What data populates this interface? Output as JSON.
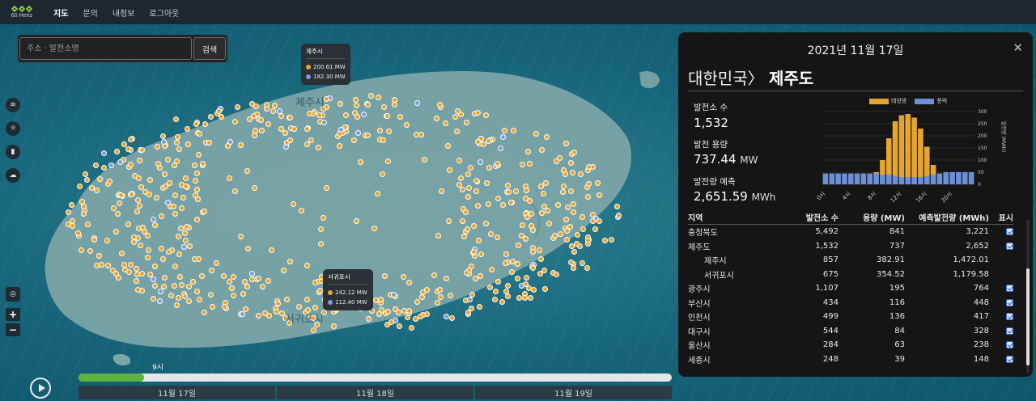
{
  "nav": {
    "logo_text": "60 Hertz",
    "links": [
      "지도",
      "문의",
      "내정보",
      "로그아웃"
    ]
  },
  "search": {
    "placeholder": "주소 · 발전소명",
    "button": "검색"
  },
  "map": {
    "labels": [
      "제주시",
      "서귀포시"
    ],
    "popup_jeju": {
      "title": "제주시",
      "solar": "200.61 MW",
      "wind": "182.30 MW"
    },
    "popup_seogwipo": {
      "title": "서귀포시",
      "solar": "242.12 MW",
      "wind": "112.40 MW"
    },
    "colors": {
      "solar": "#e6a531",
      "wind": "#7e9bd6"
    }
  },
  "timeline": {
    "current": "9시",
    "progress": 0.11,
    "dates": [
      "11월 17일",
      "11월 18일",
      "11월 19일"
    ]
  },
  "panel": {
    "date": "2021년 11월 17일",
    "region_parent": "대한민국〉",
    "region": "제주도",
    "stats": {
      "count_label": "발전소 수",
      "count": "1,532",
      "capacity_label": "발전 용량",
      "capacity": "737.44",
      "capacity_unit": "MW",
      "forecast_label": "발전량 예측",
      "forecast": "2,651.59",
      "forecast_unit": "MWh"
    },
    "table": {
      "headers": [
        "지역",
        "발전소 수",
        "용량 (MW)",
        "예측발전량 (MWh)",
        "표시"
      ],
      "rows": [
        [
          "충청북도",
          "5,492",
          "841",
          "3,221"
        ],
        [
          "제주도",
          "1,532",
          "737",
          "2,652"
        ],
        [
          "제주시",
          "857",
          "382.91",
          "1,472.01"
        ],
        [
          "서귀포시",
          "675",
          "354.52",
          "1,179.58"
        ],
        [
          "광주시",
          "1,107",
          "195",
          "764"
        ],
        [
          "부산시",
          "434",
          "116",
          "448"
        ],
        [
          "인천시",
          "499",
          "136",
          "417"
        ],
        [
          "대구시",
          "544",
          "84",
          "328"
        ],
        [
          "울산시",
          "284",
          "63",
          "238"
        ],
        [
          "세종시",
          "248",
          "39",
          "148"
        ]
      ],
      "sub_rows": [
        2,
        3
      ]
    }
  },
  "chart_data": {
    "type": "bar",
    "stacked": true,
    "legend_position": "top",
    "categories": [
      "0시",
      "1시",
      "2시",
      "3시",
      "4시",
      "5시",
      "6시",
      "7시",
      "8시",
      "9시",
      "10시",
      "11시",
      "12시",
      "13시",
      "14시",
      "15시",
      "16시",
      "17시",
      "18시",
      "19시",
      "20시",
      "21시",
      "22시",
      "23시"
    ],
    "tick_labels": [
      "0시",
      "4시",
      "8시",
      "12시",
      "16시",
      "20시"
    ],
    "series": [
      {
        "name": "태양광",
        "color": "#e6a531",
        "values": [
          0,
          0,
          0,
          0,
          0,
          0,
          0,
          0,
          5,
          60,
          150,
          225,
          255,
          260,
          245,
          200,
          120,
          40,
          0,
          0,
          0,
          0,
          0,
          0
        ]
      },
      {
        "name": "풍력",
        "color": "#6d8fd8",
        "values": [
          45,
          45,
          45,
          45,
          45,
          45,
          45,
          45,
          45,
          40,
          40,
          35,
          30,
          30,
          30,
          30,
          35,
          40,
          45,
          50,
          50,
          50,
          50,
          50
        ]
      }
    ],
    "ylim": [
      0,
      300
    ],
    "yticks": [
      0,
      50,
      100,
      150,
      200,
      250,
      300
    ],
    "ylabel": "발전량 (MWh)"
  }
}
